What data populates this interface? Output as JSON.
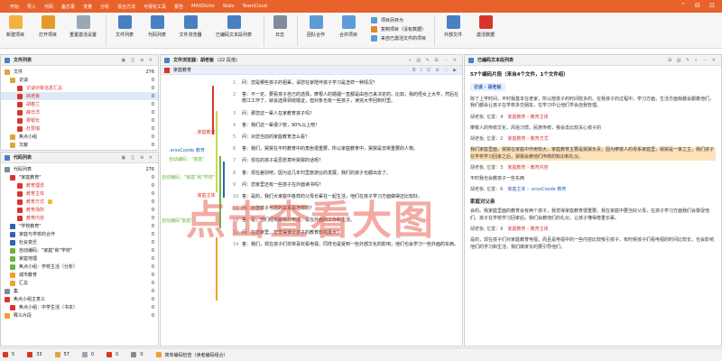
{
  "menu": [
    "开始",
    "导入",
    "代码",
    "备忘录",
    "变量",
    "分析",
    "混合方法",
    "可视化工具",
    "报告",
    "MAXDictio",
    "Stats",
    "TeamCloud"
  ],
  "ribbon": {
    "buttons": [
      "新建项目",
      "打开项目",
      "重置激活设置",
      "文件列表",
      "代码列表",
      "文件浏览器",
      "已编码文本段列表",
      "日志",
      "团队合作",
      "合并项目",
      "外部文件",
      "激活数据"
    ],
    "list": [
      "项目另存为",
      "复制项目（没有数据）",
      "来自已激活文件的项目"
    ]
  },
  "doc_system": {
    "title": "文件列表",
    "header_left": "文件",
    "header_right": "276",
    "rows": [
      {
        "label": "文件",
        "count": "276"
      },
      {
        "label": "访谈",
        "count": "0"
      },
      {
        "label": "访谈对象信息汇总",
        "count": "0"
      },
      {
        "label": "郎老板",
        "count": "0"
      },
      {
        "label": "胡春兰",
        "count": "0"
      },
      {
        "label": "薛日洋",
        "count": "0"
      },
      {
        "label": "穆银长",
        "count": "0"
      },
      {
        "label": "杜慧瑞",
        "count": "0"
      },
      {
        "label": "焦点小组",
        "count": "0"
      },
      {
        "label": "文献",
        "count": "0"
      }
    ]
  },
  "code_system": {
    "title": "代码列表",
    "rows": [
      {
        "label": "代码列表",
        "count": "276"
      },
      {
        "label": "\"家庭教育\"",
        "count": "0"
      },
      {
        "label": "教育理念",
        "count": "0"
      },
      {
        "label": "教育主体",
        "count": "0"
      },
      {
        "label": "教育方式",
        "count": "0"
      },
      {
        "label": "教育场所",
        "count": "0"
      },
      {
        "label": "教育内容",
        "count": "0"
      },
      {
        "label": "\"学校教育\"",
        "count": "0"
      },
      {
        "label": "家庭与学校的合作",
        "count": "0"
      },
      {
        "label": "社会变迁",
        "count": "0"
      },
      {
        "label": "自动编码：\"家庭\"和\"学校\"",
        "count": "0"
      },
      {
        "label": "家庭地理",
        "count": "0"
      },
      {
        "label": "焦点小组：学校主活（分析）",
        "count": "0"
      },
      {
        "label": "城市教育",
        "count": "0"
      },
      {
        "label": "汇总",
        "count": "0"
      },
      {
        "label": "集",
        "count": "0"
      },
      {
        "label": "焦点小组主意义",
        "count": "0"
      },
      {
        "label": "焦点小组：中学生活（书本）",
        "count": "0"
      },
      {
        "label": "释义片段",
        "count": "0"
      }
    ]
  },
  "browser": {
    "title": "文件浏览器：胡老板",
    "segments": "(22 段落)",
    "tab": "家庭教育",
    "para_numbers": [
      "1",
      "2",
      "3",
      "4",
      "5",
      "6",
      "7",
      "8",
      "9",
      "10",
      "11",
      "12",
      "13",
      "14"
    ],
    "paragraphs": [
      "问：您是哪些孩子的祖辈，请您在家陪伴孩子学习是怎样一种情况？",
      "答：不一定。要看孩子自己的选择，摩根人的婚姻一直都是由自己来决定的。比如，我的侄女上大学，然后在丽江工作了，就会选择领结婚证，但对象也有一些孩子，读完大学回到村里。",
      "问：那您这一辈人在家教育孩子吗？",
      "答：我们这一辈很少管，90%以上吧！",
      "问：对您当前的家庭教育怎么看？",
      "答：我们，舅舅在平时教育中的角色很重要，所以家庭教育中，舅舅是非常重要的人物。",
      "问：现在的孩子是否愿意听舅舅的话呢？",
      "答：现在差别吧，因为这几年村里旅游业的发展，我们的孩子也都出去了。",
      "问：您家里还有一些孩子在外面读书吗？",
      "答：是的，我们大家庭中各样的父母长辈在一起生活，他们在孩子学习方面做得还比较好。",
      "问：对您孩子与您的关系是怎样的？",
      "答：是，他们经常跟我打电话，说在外面的工作和生活。",
      "问：在您家里，您觉得谁对孩子的教育影响最大？",
      "答：我们，现在孩子们非常喜欢看电视，同样也是受到一些外部文化的影响，他们也会学习一些外面的东西。"
    ],
    "stripes": [
      ".ersoCoode 教育",
      "自动编码：\"家庭\"",
      ".家庭教育",
      ".家庭主体",
      "自动编码：\"家庭\"和\"学校\"",
      "自动编码\"家庭\""
    ]
  },
  "retrieved": {
    "title": "已编码文本段列表",
    "summary": "57个编码片段（来自4个文件，1个文件组）",
    "doc_label": "访谈 › 胡老板",
    "source_tag": "胡老板, 位置：4",
    "source_code": "家庭教育 › 教育主体",
    "text_blocks": [
      "除了上学时间，平时我基本在老家，所以陪孩子的时间较多的。在我孩子的过程中，学习方面，生活方面我都会跟着他们，我们都会让孩子在学校多交朋友，在学习中让他们学会自我管理。",
      "摩梭人的传统文化，风俗习惯，民族传统，我会去比较关心孩子的",
      "我们家庭里面，舅舅在家庭中作用较大，家庭教育主要是舅舅负责，因为摩梭人的母系家庭里，舅舅是一家之主，我们孩子在学校学习回家之后，舅舅会教他们传统的知识和礼仪。",
      "平时我也会教孩子一些东西",
      "会的。我家庭里面的教育会有两个孩子，我觉得家庭教育很重要。我在家庭中要当好父母，在孩子学习方面我们会督促他们。孩子在学校学习回家后，我们会教他们的礼仪，让孩子懂得尊重长辈。",
      "是的，现在孩子们对家庭教育电视，而且是电视中的一些内容比较吸引孩子，有时候孩子们看电视的时间比较长，也会影响他们的学习和生活，我们做家长的要引导他们。"
    ],
    "items": [
      {
        "source": "胡老板, 位置：2",
        "code": "家庭教育 › 教育方式"
      },
      {
        "source": "胡老板, 位置：3",
        "code": "家庭教育 › 教育内容"
      },
      {
        "source": "胡老板, 位置：6",
        "code": "家庭主体 › .ersoCoode 教育"
      },
      {
        "source": "胡老板, 位置：9",
        "code": "家庭教育 › 教育主体"
      }
    ],
    "subheading": "家庭对父亲"
  },
  "status": {
    "docs": "5",
    "codes": "33",
    "memos": "57",
    "variables": "0",
    "links": "0",
    "sets": "0",
    "hint": "简单编码检查（读者编码组合）"
  },
  "watermark": "点击查看大图",
  "colors": {
    "accent": "#e8632b",
    "code_red": "#d9342b",
    "code_blue": "#2d63b8",
    "code_green": "#6bb544",
    "code_orange": "#f0a030",
    "stripe_green": "#c8d84b"
  }
}
